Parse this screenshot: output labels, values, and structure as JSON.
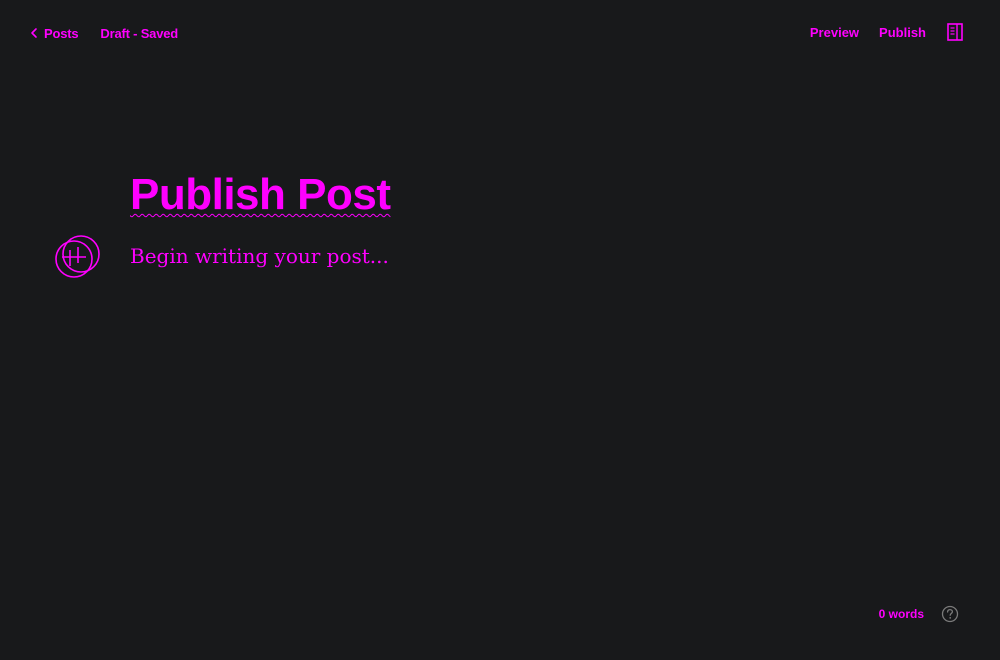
{
  "header": {
    "back_label": "Posts",
    "status": "Draft - Saved",
    "preview_label": "Preview",
    "publish_label": "Publish"
  },
  "editor": {
    "title": "Publish Post",
    "body_placeholder": "Begin writing your post..."
  },
  "footer": {
    "word_count": "0 words"
  },
  "icons": {
    "back": "chevron-left-icon",
    "settings": "sidebar-panel-icon",
    "add_block": "plus-circle-icon",
    "help": "question-mark-icon"
  },
  "colors": {
    "background": "#18191b",
    "accent": "#ff00ff",
    "muted_icon": "#7a7a7a"
  }
}
